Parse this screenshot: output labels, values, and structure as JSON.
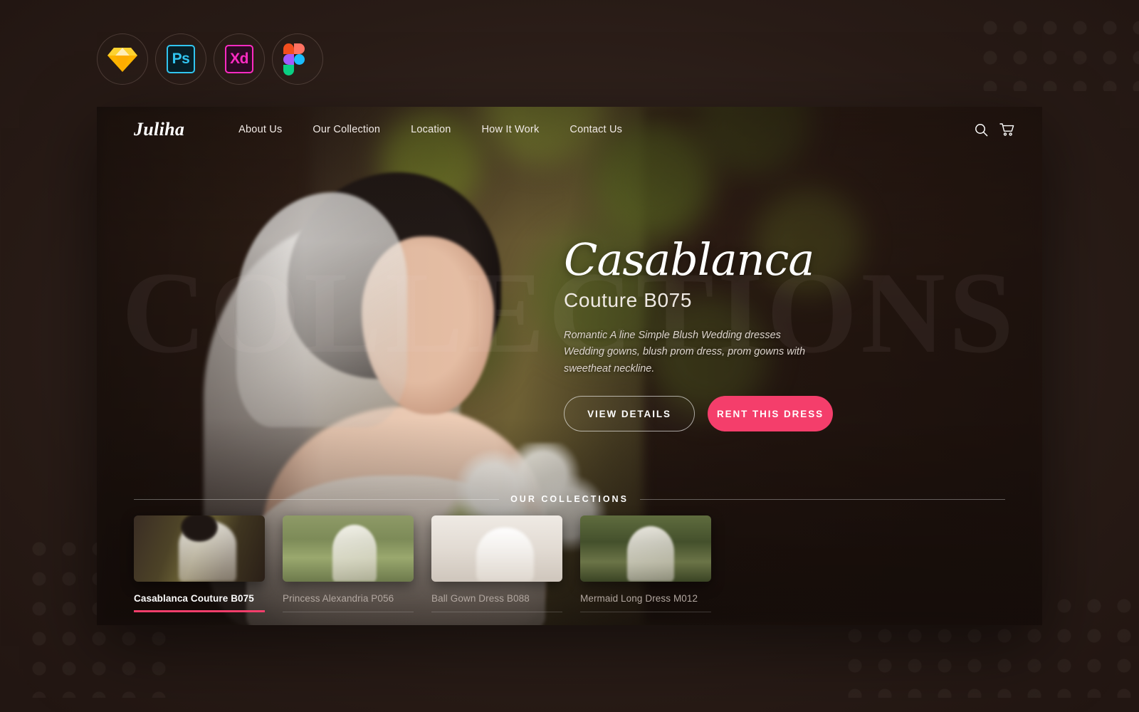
{
  "tools": [
    {
      "name": "sketch",
      "label": "Sketch"
    },
    {
      "name": "photoshop",
      "label": "Ps"
    },
    {
      "name": "adobe-xd",
      "label": "Xd"
    },
    {
      "name": "figma",
      "label": "Figma"
    }
  ],
  "site": {
    "logo": "Juliha",
    "watermark": "COLLECTIONS",
    "nav": [
      {
        "label": "About Us"
      },
      {
        "label": "Our Collection"
      },
      {
        "label": "Location"
      },
      {
        "label": "How It Work"
      },
      {
        "label": "Contact Us"
      }
    ],
    "icons": {
      "search": "search-icon",
      "cart": "cart-icon"
    }
  },
  "hero": {
    "script_title": "Casablanca",
    "sub_title": "Couture B075",
    "description": "Romantic A line Simple Blush Wedding dresses Wedding gowns, blush prom dress, prom gowns with sweetheat neckline.",
    "buttons": {
      "secondary": "VIEW DETAILS",
      "primary": "RENT THIS DRESS"
    }
  },
  "collections": {
    "heading": "OUR COLLECTIONS",
    "items": [
      {
        "label": "Casablanca Couture B075",
        "active": true
      },
      {
        "label": "Princess Alexandria P056",
        "active": false
      },
      {
        "label": "Ball Gown Dress B088",
        "active": false
      },
      {
        "label": "Mermaid Long Dress M012",
        "active": false
      }
    ]
  },
  "colors": {
    "accent_pink": "#f43e6b",
    "page_background": "#2b1d19",
    "text_light": "#ffffff",
    "text_muted": "#b4a9a2"
  }
}
